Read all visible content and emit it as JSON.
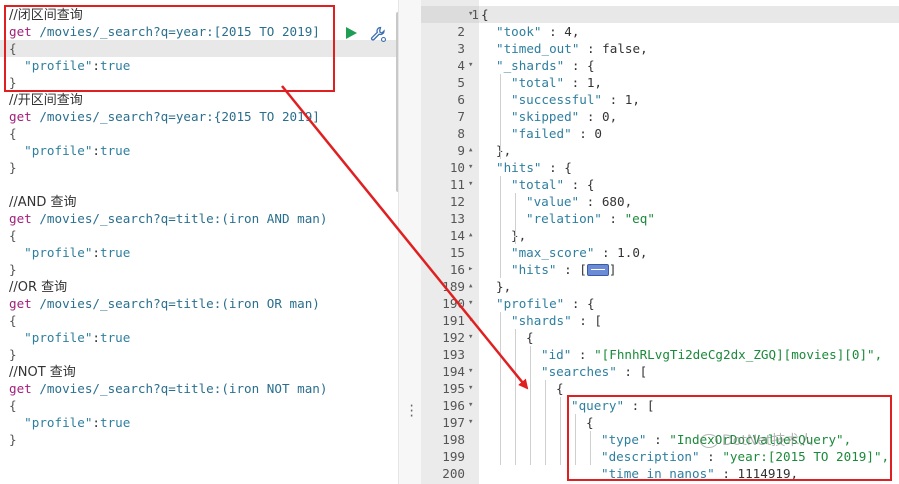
{
  "left_editor": {
    "lines": [
      {
        "type": "comment",
        "text": "//闭区间查询"
      },
      {
        "type": "request",
        "method": "get",
        "url": "/movies/_search?q=year:[2015 TO 2019]"
      },
      {
        "type": "brace",
        "text": "{"
      },
      {
        "type": "body",
        "key": "\"profile\"",
        "value": "true"
      },
      {
        "type": "brace",
        "text": "}"
      },
      {
        "type": "comment",
        "text": "//开区间查询"
      },
      {
        "type": "request",
        "method": "get",
        "url": "/movies/_search?q=year:{2015 TO 2019]"
      },
      {
        "type": "brace",
        "text": "{"
      },
      {
        "type": "body",
        "key": "\"profile\"",
        "value": "true"
      },
      {
        "type": "brace",
        "text": "}"
      },
      {
        "type": "blank",
        "text": ""
      },
      {
        "type": "comment",
        "text": "//AND 查询"
      },
      {
        "type": "request",
        "method": "get",
        "url": "/movies/_search?q=title:(iron AND man)"
      },
      {
        "type": "brace",
        "text": "{"
      },
      {
        "type": "body",
        "key": "\"profile\"",
        "value": "true"
      },
      {
        "type": "brace",
        "text": "}"
      },
      {
        "type": "comment",
        "text": "//OR 查询"
      },
      {
        "type": "request",
        "method": "get",
        "url": "/movies/_search?q=title:(iron OR man)"
      },
      {
        "type": "brace",
        "text": "{"
      },
      {
        "type": "body",
        "key": "\"profile\"",
        "value": "true"
      },
      {
        "type": "brace",
        "text": "}"
      },
      {
        "type": "comment",
        "text": "//NOT 查询"
      },
      {
        "type": "request",
        "method": "get",
        "url": "/movies/_search?q=title:(iron NOT man)"
      },
      {
        "type": "brace",
        "text": "{"
      },
      {
        "type": "body",
        "key": "\"profile\"",
        "value": "true"
      },
      {
        "type": "brace",
        "text": "}"
      }
    ]
  },
  "response": {
    "lines": [
      {
        "n": "1",
        "fold": "▾",
        "indent": 0,
        "text": "{"
      },
      {
        "n": "2",
        "indent": 1,
        "key": "\"took\"",
        "sep": " : ",
        "num": "4,"
      },
      {
        "n": "3",
        "indent": 1,
        "key": "\"timed_out\"",
        "sep": " : ",
        "num": "false,"
      },
      {
        "n": "4",
        "fold": "▾",
        "indent": 1,
        "key": "\"_shards\"",
        "sep": " : ",
        "num": "{"
      },
      {
        "n": "5",
        "indent": 2,
        "key": "\"total\"",
        "sep": " : ",
        "num": "1,"
      },
      {
        "n": "6",
        "indent": 2,
        "key": "\"successful\"",
        "sep": " : ",
        "num": "1,"
      },
      {
        "n": "7",
        "indent": 2,
        "key": "\"skipped\"",
        "sep": " : ",
        "num": "0,"
      },
      {
        "n": "8",
        "indent": 2,
        "key": "\"failed\"",
        "sep": " : ",
        "num": "0"
      },
      {
        "n": "9",
        "fold": "▴",
        "indent": 1,
        "text": "},"
      },
      {
        "n": "10",
        "fold": "▾",
        "indent": 1,
        "key": "\"hits\"",
        "sep": " : ",
        "num": "{"
      },
      {
        "n": "11",
        "fold": "▾",
        "indent": 2,
        "key": "\"total\"",
        "sep": " : ",
        "num": "{"
      },
      {
        "n": "12",
        "indent": 3,
        "key": "\"value\"",
        "sep": " : ",
        "num": "680,"
      },
      {
        "n": "13",
        "indent": 3,
        "key": "\"relation\"",
        "sep": " : ",
        "str": "\"eq\""
      },
      {
        "n": "14",
        "fold": "▴",
        "indent": 2,
        "text": "},"
      },
      {
        "n": "15",
        "indent": 2,
        "key": "\"max_score\"",
        "sep": " : ",
        "num": "1.0,"
      },
      {
        "n": "16",
        "fold": "▸",
        "indent": 2,
        "key": "\"hits\"",
        "sep": " : ",
        "num": "[",
        "collapsed": true,
        "after": "]"
      },
      {
        "n": "189",
        "fold": "▴",
        "indent": 1,
        "text": "},"
      },
      {
        "n": "190",
        "fold": "▾",
        "indent": 1,
        "key": "\"profile\"",
        "sep": " : ",
        "num": "{"
      },
      {
        "n": "191",
        "fold": "▾",
        "indent": 2,
        "key": "\"shards\"",
        "sep": " : ",
        "num": "["
      },
      {
        "n": "192",
        "fold": "▾",
        "indent": 3,
        "text": "{"
      },
      {
        "n": "193",
        "indent": 4,
        "key": "\"id\"",
        "sep": " : ",
        "str": "\"[FhnhRLvgTi2deCg2dx_ZGQ][movies][0]\","
      },
      {
        "n": "194",
        "fold": "▾",
        "indent": 4,
        "key": "\"searches\"",
        "sep": " : ",
        "num": "["
      },
      {
        "n": "195",
        "fold": "▾",
        "indent": 5,
        "text": "{"
      },
      {
        "n": "196",
        "fold": "▾",
        "indent": 6,
        "key": "\"query\"",
        "sep": " : ",
        "num": "["
      },
      {
        "n": "197",
        "fold": "▾",
        "indent": 7,
        "text": "{"
      },
      {
        "n": "198",
        "indent": 8,
        "key": "\"type\"",
        "sep": " : ",
        "str": "\"IndexOrDocValuesQuery\","
      },
      {
        "n": "199",
        "indent": 8,
        "key": "\"description\"",
        "sep": " : ",
        "str": "\"year:[2015 TO 2019]\","
      },
      {
        "n": "200",
        "indent": 8,
        "key": "\"time_in_nanos\"",
        "sep": " : ",
        "num": "1114919,"
      }
    ]
  },
  "watermark": {
    "text": "DotNet技术人"
  },
  "colors": {
    "highlight": "#e02020",
    "method": "#a11f7a",
    "key": "#2e7f9f",
    "string": "#1a8a3a"
  },
  "icons": {
    "run": "play-icon",
    "settings": "wrench-icon"
  }
}
